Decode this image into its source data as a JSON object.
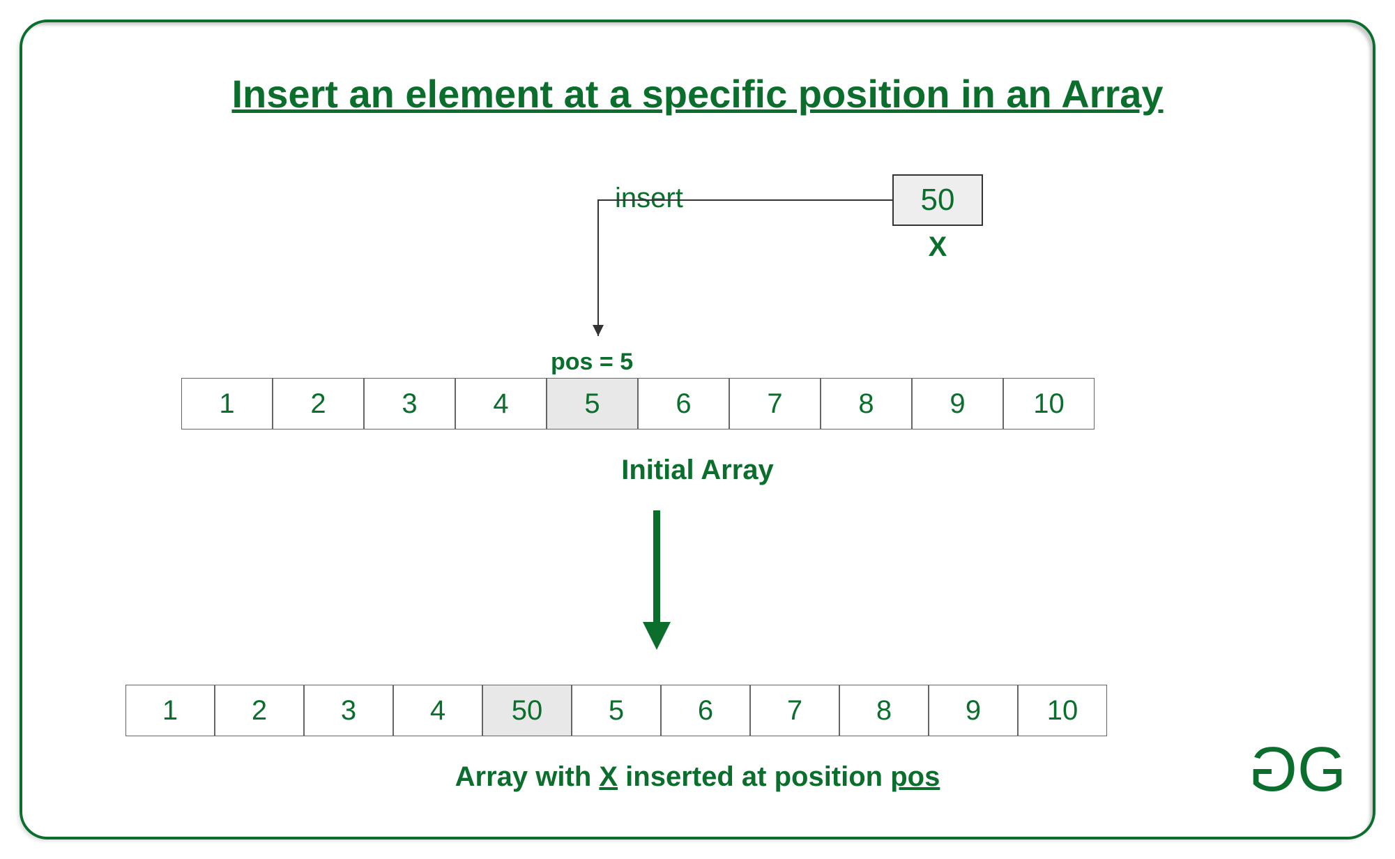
{
  "title": "Insert an element at a specific position in an Array",
  "insert_label": "insert",
  "x_value": "50",
  "x_label": "X",
  "pos_label": "pos = 5",
  "initial_array_label": "Initial Array",
  "result_label_prefix": "Array with ",
  "result_label_x": "X",
  "result_label_mid": " inserted at position ",
  "result_label_pos": "pos",
  "initial_array": [
    "1",
    "2",
    "3",
    "4",
    "5",
    "6",
    "7",
    "8",
    "9",
    "10"
  ],
  "result_array": [
    "1",
    "2",
    "3",
    "4",
    "50",
    "5",
    "6",
    "7",
    "8",
    "9",
    "10"
  ],
  "highlight_index_initial": 4,
  "highlight_index_result": 4,
  "logo": {
    "left": "G",
    "right": "G"
  },
  "colors": {
    "primary": "#0b6e2d",
    "cell_border": "#666666",
    "highlight": "#e8e8e8"
  }
}
